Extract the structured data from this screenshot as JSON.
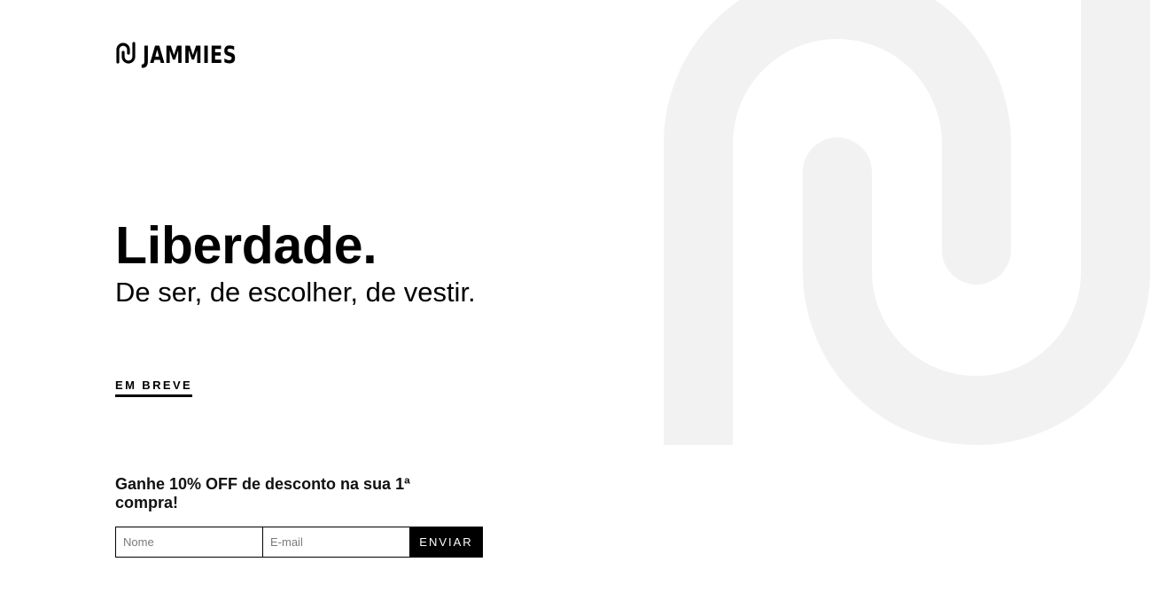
{
  "brand": {
    "name": "JAMMIES",
    "logo_icon": "jammies-monogram-icon",
    "watermark_icon": "jammies-monogram-watermark",
    "watermark_color": "#f2f2f2"
  },
  "hero": {
    "headline": "Liberdade.",
    "subheadline": "De ser, de escolher, de vestir."
  },
  "cta": {
    "coming_soon": "EM BREVE"
  },
  "signup": {
    "promo_text": "Ganhe 10% OFF de desconto na sua 1ª compra!",
    "name_placeholder": "Nome",
    "email_placeholder": "E-mail",
    "submit_label": "ENVIAR"
  },
  "colors": {
    "text": "#000000",
    "button_bg": "#000000",
    "button_text": "#ffffff",
    "background": "#ffffff"
  }
}
